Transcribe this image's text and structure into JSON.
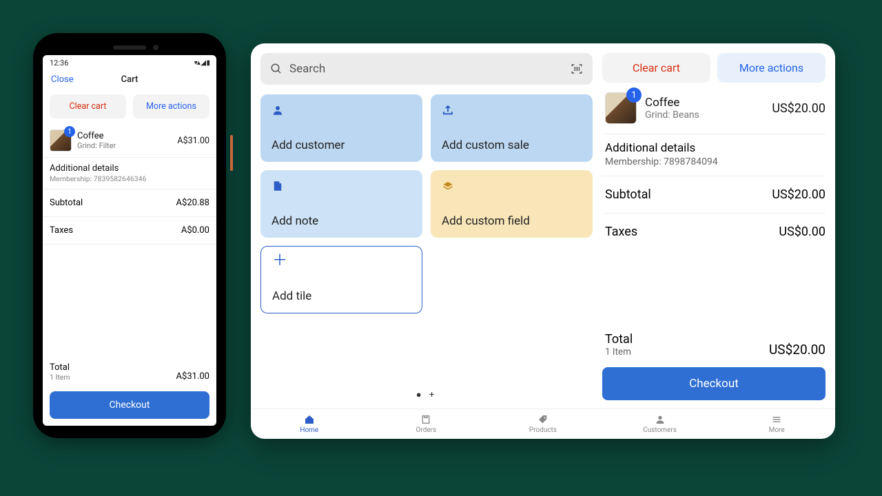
{
  "phone": {
    "status_time": "12:36",
    "close": "Close",
    "title": "Cart",
    "clear_cart": "Clear cart",
    "more_actions": "More actions",
    "item": {
      "badge": "1",
      "name": "Coffee",
      "variant": "Grind: Filter",
      "price": "A$31.00"
    },
    "details_title": "Additional details",
    "details_line": "Membership: 7839582646346",
    "subtotal_label": "Subtotal",
    "subtotal_value": "A$20.88",
    "taxes_label": "Taxes",
    "taxes_value": "A$0.00",
    "total_label": "Total",
    "total_sub": "1 Item",
    "total_value": "A$31.00",
    "checkout": "Checkout"
  },
  "tablet": {
    "search_placeholder": "Search",
    "tiles": {
      "add_customer": "Add customer",
      "add_custom_sale": "Add custom sale",
      "add_note": "Add note",
      "add_custom_field": "Add custom field",
      "add_tile": "Add tile"
    },
    "cart": {
      "clear_cart": "Clear cart",
      "more_actions": "More actions",
      "item": {
        "badge": "1",
        "name": "Coffee",
        "variant": "Grind: Beans",
        "price": "US$20.00"
      },
      "details_title": "Additional details",
      "details_line": "Membership: 7898784094",
      "subtotal_label": "Subtotal",
      "subtotal_value": "US$20.00",
      "taxes_label": "Taxes",
      "taxes_value": "US$0.00",
      "total_label": "Total",
      "total_sub": "1 Item",
      "total_value": "US$20.00",
      "checkout": "Checkout"
    },
    "nav": {
      "home": "Home",
      "orders": "Orders",
      "products": "Products",
      "customers": "Customers",
      "more": "More"
    }
  }
}
